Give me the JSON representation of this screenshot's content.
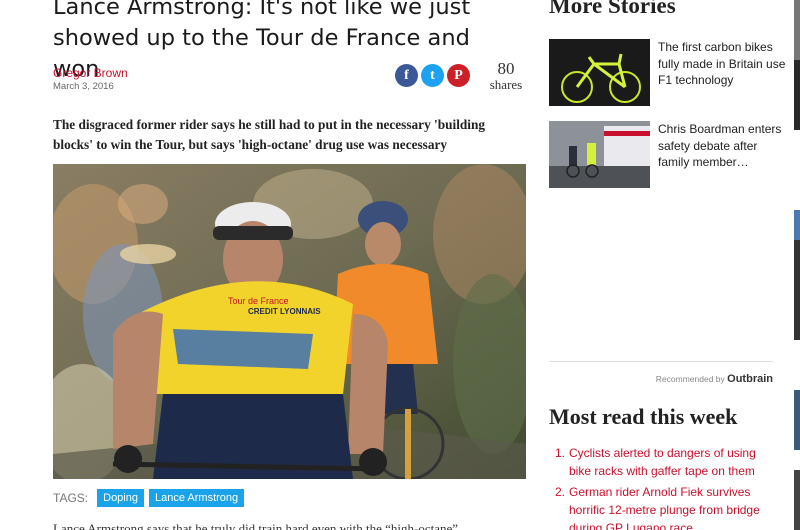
{
  "article": {
    "headline": "Lance Armstrong: It's not like we just showed up to the Tour de France and won",
    "author": "Gregor Brown",
    "date": "March 3, 2016",
    "share_count": "80",
    "share_label": "shares",
    "standfirst": "The disgraced former rider says he still had to put in the necessary 'building blocks' to win the Tour, but says 'high-octane' drug use was necessary",
    "tags_label": "TAGS:",
    "tags": [
      "Doping",
      "Lance Armstrong"
    ],
    "body_start": "Lance Armstrong says that he truly did train hard even with the “high-octane”"
  },
  "share": {
    "facebook_glyph": "f",
    "twitter_glyph": "t",
    "pinterest_glyph": "P"
  },
  "hero_icons": {
    "jersey_logo": "Tour de France",
    "jersey_sponsor": "CREDIT LYONNAIS"
  },
  "sidebar": {
    "more_title": "More Stories",
    "stories": [
      {
        "title": "The first carbon bikes fully made in Britain use F1 technology"
      },
      {
        "title": "Chris Boardman enters safety debate after family member…"
      }
    ],
    "recommended_by": "Recommended by",
    "outbrain_brand": "Outbrain",
    "most_read_title": "Most read this week",
    "most_read": [
      {
        "n": "1.",
        "title": "Cyclists alerted to dangers of using bike racks with gaffer tape on them"
      },
      {
        "n": "2.",
        "title": "German rider Arnold Fiek survives horrific 12-metre plunge from bridge during GP Lugano race"
      }
    ]
  },
  "colors": {
    "accent_red": "#c8102e",
    "tag_blue": "#1aa3e8",
    "facebook": "#3b5998",
    "twitter": "#1da1f2",
    "pinterest": "#cb2027"
  }
}
